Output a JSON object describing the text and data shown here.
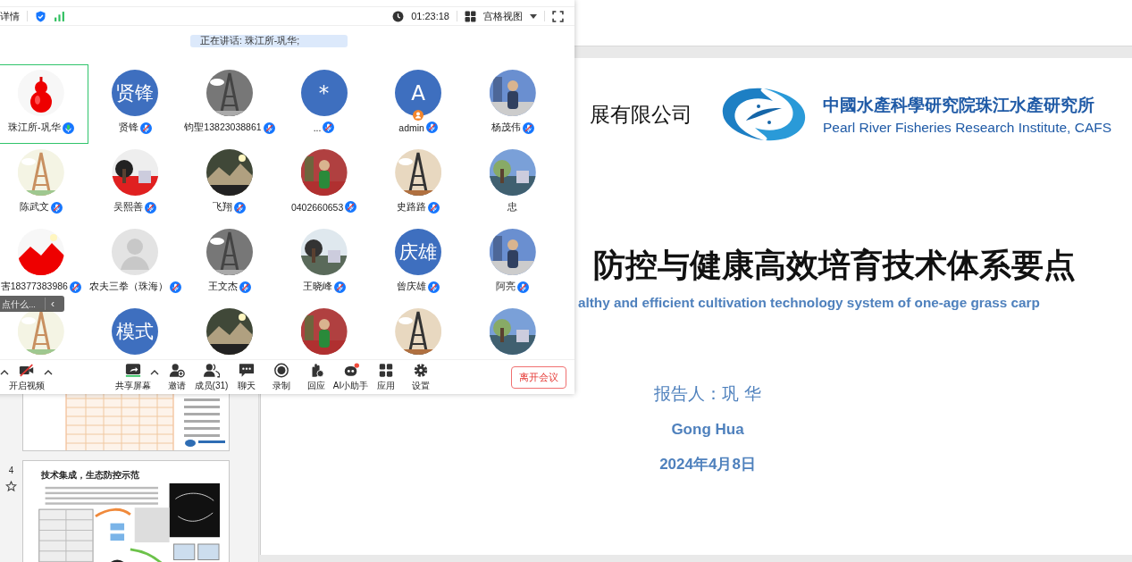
{
  "presentation": {
    "thumbnails": [
      {
        "kind": "table"
      },
      {
        "kind": "diagram",
        "number": "4",
        "starred": true,
        "title": "技术集成，生态防控示范"
      }
    ],
    "slide": {
      "company_text": "展有限公司",
      "institute_name_cn": "中國水產科學研究院珠江水產研究所",
      "institute_name_en": "Pearl River Fisheries Research Institute, CAFS",
      "title": "防控与健康高效培育技术体系要点",
      "subtitle": "althy and efficient cultivation technology system of one-age grass carp",
      "presenter": "报告人：巩 华",
      "presenter_en": "Gong Hua",
      "date": "2024年4月8日"
    }
  },
  "meeting_window": {
    "top_bar": {
      "details_label": "详情",
      "timer": "01:23:18",
      "view_label": "宫格视图"
    },
    "speaking_banner": "正在讲话: 珠江所-巩华;",
    "participants": [
      {
        "name": "珠江所-巩华",
        "muted": false,
        "host": false,
        "speaking": true
      },
      {
        "name": "贤锋",
        "avatar": {
          "kind": "initials",
          "text": "贤锋"
        },
        "muted": true,
        "host": false,
        "speaking": false
      },
      {
        "name": "钧聖13823038861",
        "muted": true,
        "host": false,
        "speaking": false
      },
      {
        "name": "...",
        "avatar": {
          "kind": "initials",
          "text": "*"
        },
        "muted": true,
        "host": false,
        "speaking": false
      },
      {
        "name": "admin",
        "avatar": {
          "kind": "initials",
          "text": "A"
        },
        "muted": true,
        "host": true,
        "speaking": false
      },
      {
        "name": "杨茂伟",
        "muted": true,
        "host": false,
        "speaking": false
      },
      {
        "name": "陈武文",
        "muted": true,
        "host": false,
        "speaking": false
      },
      {
        "name": "吴熙善",
        "muted": true,
        "host": false,
        "speaking": false
      },
      {
        "name": "飞翔",
        "muted": true,
        "host": false,
        "speaking": false
      },
      {
        "name": "0402660653",
        "muted": true,
        "host": false,
        "speaking": false
      },
      {
        "name": "史路路",
        "muted": true,
        "host": false,
        "speaking": false
      },
      {
        "name": "忠",
        "host": false,
        "speaking": false
      },
      {
        "name": "害18377383986",
        "muted": true,
        "host": false,
        "speaking": false
      },
      {
        "name": "农夫三拳（珠海）",
        "avatar": {
          "kind": "default"
        },
        "muted": true,
        "host": false,
        "speaking": false
      },
      {
        "name": "王文杰",
        "muted": true,
        "host": false,
        "speaking": false
      },
      {
        "name": "王晓峰",
        "muted": true,
        "host": false,
        "speaking": false
      },
      {
        "name": "曾庆雄",
        "avatar": {
          "kind": "initials",
          "text": "庆雄"
        },
        "muted": true,
        "host": false,
        "speaking": false
      },
      {
        "name": "阿亮",
        "muted": true,
        "host": false,
        "speaking": false
      },
      {
        "speaking": false
      },
      {
        "avatar": {
          "kind": "initials",
          "text": "模式"
        },
        "speaking": false
      },
      {
        "speaking": false
      },
      {
        "speaking": false
      },
      {
        "speaking": false
      },
      {
        "speaking": false
      }
    ],
    "chat_input": {
      "placeholder": "点什么...",
      "collapse": "‹"
    },
    "toolbar": [
      {
        "kind": "video",
        "label": "开启视频"
      },
      {
        "kind": "share",
        "label": "共享屏幕"
      },
      {
        "kind": "invite",
        "label": "邀请"
      },
      {
        "kind": "members",
        "label": "成员(31)"
      },
      {
        "kind": "chat",
        "label": "聊天"
      },
      {
        "kind": "record",
        "label": "录制"
      },
      {
        "kind": "react",
        "label": "回应"
      },
      {
        "kind": "assistant",
        "label": "AI小助手"
      },
      {
        "kind": "apps",
        "label": "应用"
      },
      {
        "kind": "settings",
        "label": "设置"
      }
    ],
    "leave_button": "离开会议"
  }
}
